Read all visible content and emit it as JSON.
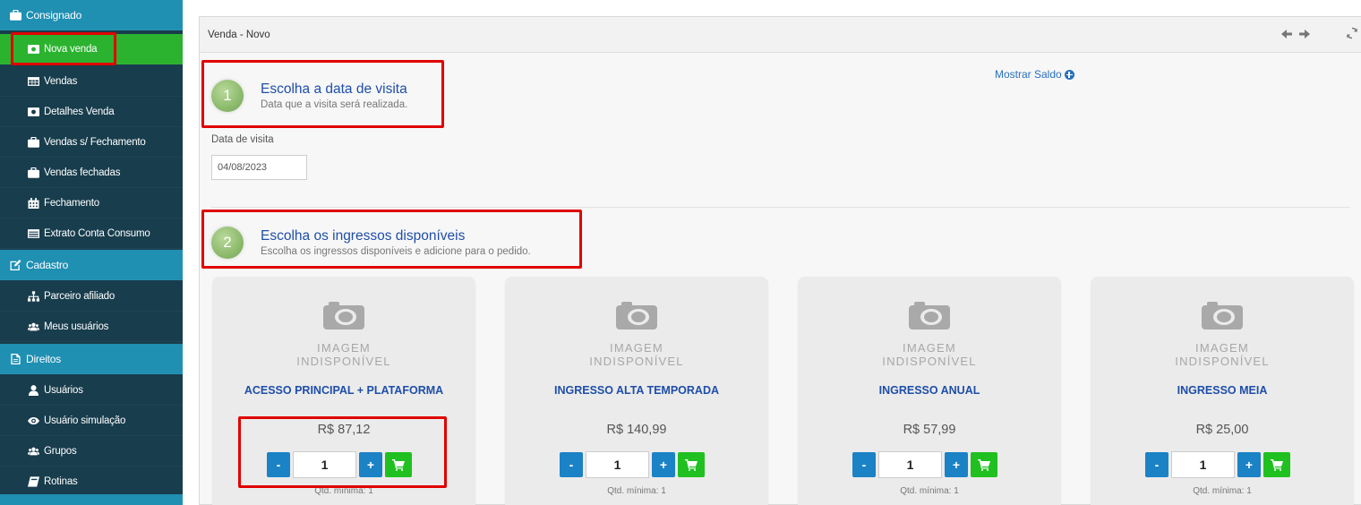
{
  "sidebar": {
    "items": [
      {
        "label": "Consignado",
        "icon": "briefcase-icon",
        "kind": "section"
      },
      {
        "label": "Nova venda",
        "icon": "money-icon",
        "kind": "active"
      },
      {
        "label": "Vendas",
        "icon": "table-icon",
        "kind": "sub"
      },
      {
        "label": "Detalhes Venda",
        "icon": "money-icon",
        "kind": "sub"
      },
      {
        "label": "Vendas s/ Fechamento",
        "icon": "briefcase-icon",
        "kind": "sub"
      },
      {
        "label": "Vendas fechadas",
        "icon": "briefcase-icon",
        "kind": "sub"
      },
      {
        "label": "Fechamento",
        "icon": "calendar-icon",
        "kind": "sub"
      },
      {
        "label": "Extrato Conta Consumo",
        "icon": "list-icon",
        "kind": "sub"
      },
      {
        "label": "Cadastro",
        "icon": "edit-icon",
        "kind": "section"
      },
      {
        "label": "Parceiro afiliado",
        "icon": "sitemap-icon",
        "kind": "sub"
      },
      {
        "label": "Meus usuários",
        "icon": "users-icon",
        "kind": "sub"
      },
      {
        "label": "Direitos",
        "icon": "file-icon",
        "kind": "section"
      },
      {
        "label": "Usuários",
        "icon": "user-icon",
        "kind": "sub"
      },
      {
        "label": "Usuário simulação",
        "icon": "eye-icon",
        "kind": "sub"
      },
      {
        "label": "Grupos",
        "icon": "users-icon",
        "kind": "sub"
      },
      {
        "label": "Rotinas",
        "icon": "book-icon",
        "kind": "sub"
      }
    ]
  },
  "panel": {
    "title": "Venda - Novo",
    "mostrar_saldo": "Mostrar Saldo"
  },
  "step1": {
    "number": "1",
    "title": "Escolha a data de visita",
    "subtitle": "Data que a visita será realizada."
  },
  "date": {
    "label": "Data de visita",
    "value": "04/08/2023"
  },
  "step2": {
    "number": "2",
    "title": "Escolha os ingressos disponíveis",
    "subtitle": "Escolha os ingressos disponíveis e adicione para o pedido."
  },
  "image_placeholder": {
    "line1": "IMAGEM",
    "line2": "INDISPONÍVEL"
  },
  "products": [
    {
      "name": "ACESSO PRINCIPAL + PLATAFORMA",
      "price": "R$ 87,12",
      "qty": "1",
      "min_qty": "Qtd. mínima: 1"
    },
    {
      "name": "INGRESSO ALTA TEMPORADA",
      "price": "R$ 140,99",
      "qty": "1",
      "min_qty": "Qtd. mínima: 1"
    },
    {
      "name": "INGRESSO ANUAL",
      "price": "R$ 57,99",
      "qty": "1",
      "min_qty": "Qtd. mínima: 1"
    },
    {
      "name": "INGRESSO MEIA",
      "price": "R$ 25,00",
      "qty": "1",
      "min_qty": "Qtd. mínima: 1"
    }
  ],
  "buttons": {
    "minus": "-",
    "plus": "+"
  },
  "colors": {
    "sidebar_bg": "#183d4d",
    "section_bg": "#1f8fb2",
    "active_bg": "#2bb32f",
    "link_blue": "#1e4ea8",
    "button_blue": "#1b82c6",
    "cart_green": "#20c020",
    "highlight_red": "#e00000"
  }
}
